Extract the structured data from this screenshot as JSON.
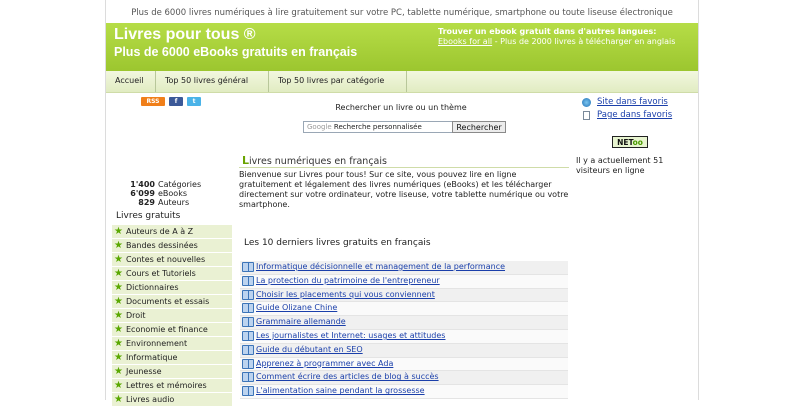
{
  "tagline": "Plus de 6000 livres numériques à lire gratuitement sur votre PC, tablette numérique, smartphone ou toute liseuse électronique",
  "header": {
    "title": "Livres pour tous ®",
    "subtitle": "Plus de 6000 eBooks gratuits en français",
    "other_lang_title": "Trouver un ebook gratuit dans d'autres langues:",
    "other_lang_link": "Ebooks for all",
    "other_lang_text": " - Plus de 2000 livres à télécharger en anglais"
  },
  "nav": [
    {
      "label": "Accueil"
    },
    {
      "label": "Top 50 livres général"
    },
    {
      "label": "Top 50 livres par catégorie"
    }
  ],
  "social": [
    "rss-icon",
    "facebook-icon",
    "twitter-icon"
  ],
  "stats": [
    {
      "num": "1'400",
      "label": "Catégories"
    },
    {
      "num": "6'099",
      "label": "eBooks"
    },
    {
      "num": "829",
      "label": "Auteurs"
    }
  ],
  "sidebar": {
    "title": "Livres gratuits",
    "items": [
      "Auteurs de A à Z",
      "Bandes dessinées",
      "Contes et nouvelles",
      "Cours et Tutoriels",
      "Dictionnaires",
      "Documents et essais",
      "Droit",
      "Economie et finance",
      "Environnement",
      "Informatique",
      "Jeunesse",
      "Lettres et mémoires",
      "Livres audio"
    ]
  },
  "search": {
    "label": "Rechercher un livre ou un thème",
    "brand": "Google",
    "placeholder": "Recherche personnalisée",
    "button": "Rechercher"
  },
  "main": {
    "title_first": "L",
    "title_rest": "ivres numériques en français",
    "intro": "Bienvenue sur Livres pour tous! Sur ce site, vous pouvez lire en ligne gratuitement et légalement des livres numériques (eBooks) et les télécharger directement sur votre ordinateur, votre liseuse, votre tablette numérique ou votre smartphone.",
    "last_title": "Les 10 derniers livres gratuits en français",
    "last_books": [
      "Informatique décisionnelle et management de la performance",
      "La protection du patrimoine de l'entrepreneur",
      "Choisir les placements qui vous conviennent",
      "Guide Olizane Chine",
      "Grammaire allemande",
      "Les journalistes et Internet: usages et attitudes",
      "Guide du débutant en SEO",
      "Apprenez à programmer avec Ada",
      "Comment écrire des articles de blog à succès",
      "L'alimentation saine pendant la grossesse"
    ]
  },
  "right": {
    "fav_site": "Site dans favoris",
    "fav_page": "Page dans favoris",
    "netoo_a": "NET",
    "netoo_b": "oo",
    "visitors": "Il y a actuellement 51 visiteurs en ligne"
  }
}
